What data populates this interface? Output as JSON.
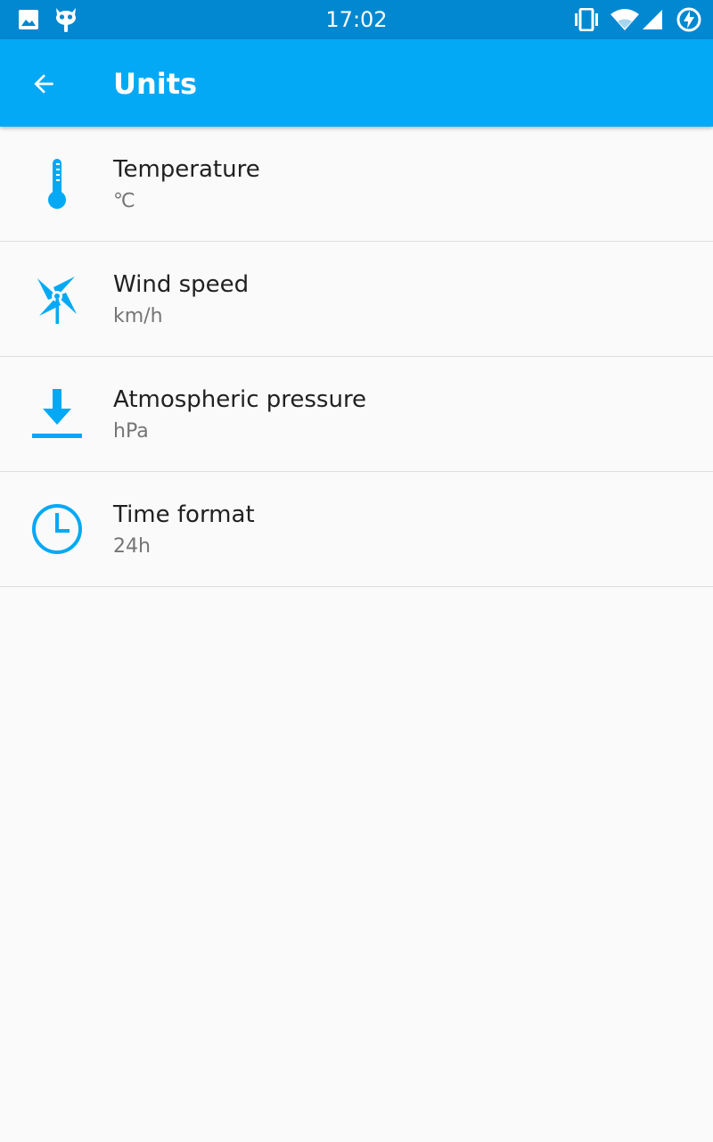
{
  "status_bar": {
    "time": "17:02",
    "left_icons": [
      "image-icon",
      "cyanogen-mascot-icon"
    ],
    "right_icons": [
      "vibrate-icon",
      "wifi-icon",
      "signal-icon",
      "battery-charging-icon"
    ]
  },
  "app_bar": {
    "title": "Units",
    "back_icon": "arrow-back-icon",
    "color": "#03a9f4"
  },
  "settings": [
    {
      "icon": "thermometer-icon",
      "title": "Temperature",
      "value": "℃"
    },
    {
      "icon": "pinwheel-icon",
      "title": "Wind speed",
      "value": "km/h"
    },
    {
      "icon": "pressure-down-arrow-icon",
      "title": "Atmospheric pressure",
      "value": "hPa"
    },
    {
      "icon": "clock-icon",
      "title": "Time format",
      "value": "24h"
    }
  ],
  "colors": {
    "status_bar": "#0288d1",
    "accent": "#03a9f4",
    "background": "#fafafa",
    "primary_text": "#212121",
    "secondary_text": "#757575"
  }
}
